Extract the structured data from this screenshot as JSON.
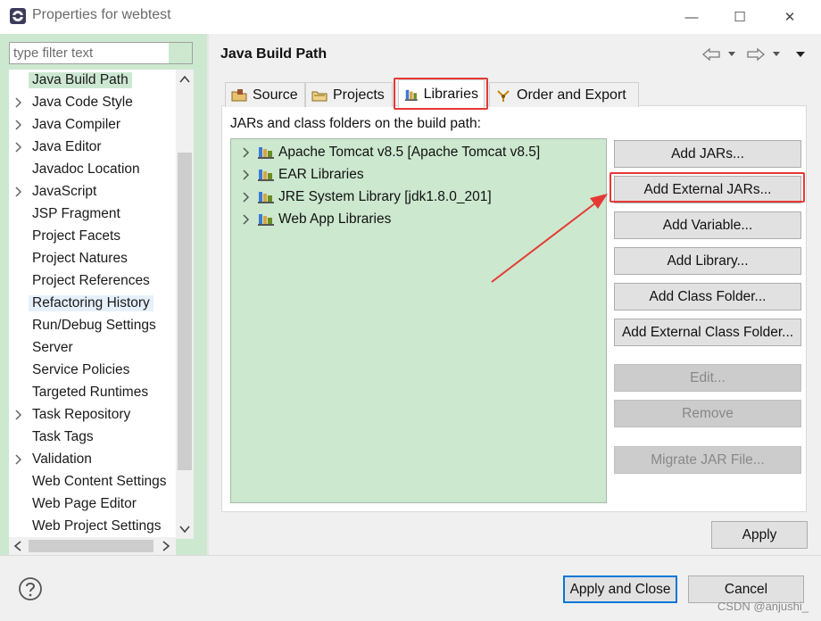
{
  "window": {
    "title": "Properties for webtest",
    "minimize": "—",
    "maximize": "☐",
    "close": "✕"
  },
  "filter": {
    "placeholder": "type filter text",
    "value": ""
  },
  "tree": {
    "items": [
      {
        "label": "Java Build Path",
        "expandable": false,
        "selected": true
      },
      {
        "label": "Java Code Style",
        "expandable": true
      },
      {
        "label": "Java Compiler",
        "expandable": true
      },
      {
        "label": "Java Editor",
        "expandable": true
      },
      {
        "label": "Javadoc Location",
        "expandable": false
      },
      {
        "label": "JavaScript",
        "expandable": true
      },
      {
        "label": "JSP Fragment",
        "expandable": false
      },
      {
        "label": "Project Facets",
        "expandable": false
      },
      {
        "label": "Project Natures",
        "expandable": false
      },
      {
        "label": "Project References",
        "expandable": false
      },
      {
        "label": "Refactoring History",
        "expandable": false,
        "hover": true
      },
      {
        "label": "Run/Debug Settings",
        "expandable": false
      },
      {
        "label": "Server",
        "expandable": false
      },
      {
        "label": "Service Policies",
        "expandable": false
      },
      {
        "label": "Targeted Runtimes",
        "expandable": false
      },
      {
        "label": "Task Repository",
        "expandable": true
      },
      {
        "label": "Task Tags",
        "expandable": false
      },
      {
        "label": "Validation",
        "expandable": true
      },
      {
        "label": "Web Content Settings",
        "expandable": false
      },
      {
        "label": "Web Page Editor",
        "expandable": false
      },
      {
        "label": "Web Project Settings",
        "expandable": false
      }
    ]
  },
  "page": {
    "title": "Java Build Path",
    "tabs": [
      {
        "id": "source",
        "label": "Source"
      },
      {
        "id": "projects",
        "label": "Projects"
      },
      {
        "id": "libraries",
        "label": "Libraries",
        "active": true
      },
      {
        "id": "order",
        "label": "Order and Export"
      }
    ],
    "build_path_label": "JARs and class folders on the build path:",
    "libraries": [
      {
        "label": "Apache Tomcat v8.5 [Apache Tomcat v8.5]"
      },
      {
        "label": "EAR Libraries"
      },
      {
        "label": "JRE System Library [jdk1.8.0_201]"
      },
      {
        "label": "Web App Libraries"
      }
    ],
    "buttons": {
      "add_jars": "Add JARs...",
      "add_external_jars": "Add External JARs...",
      "add_variable": "Add Variable...",
      "add_library": "Add Library...",
      "add_class_folder": "Add Class Folder...",
      "add_external_class_folder": "Add External Class Folder...",
      "edit": "Edit...",
      "remove": "Remove",
      "migrate_jar": "Migrate JAR File..."
    },
    "apply": "Apply"
  },
  "footer": {
    "apply_and_close": "Apply and Close",
    "cancel": "Cancel",
    "watermark": "CSDN @anjushi_"
  },
  "colors": {
    "highlight_red": "#e53935",
    "tree_green": "#cce8cf",
    "focus_blue": "#0078d7"
  }
}
